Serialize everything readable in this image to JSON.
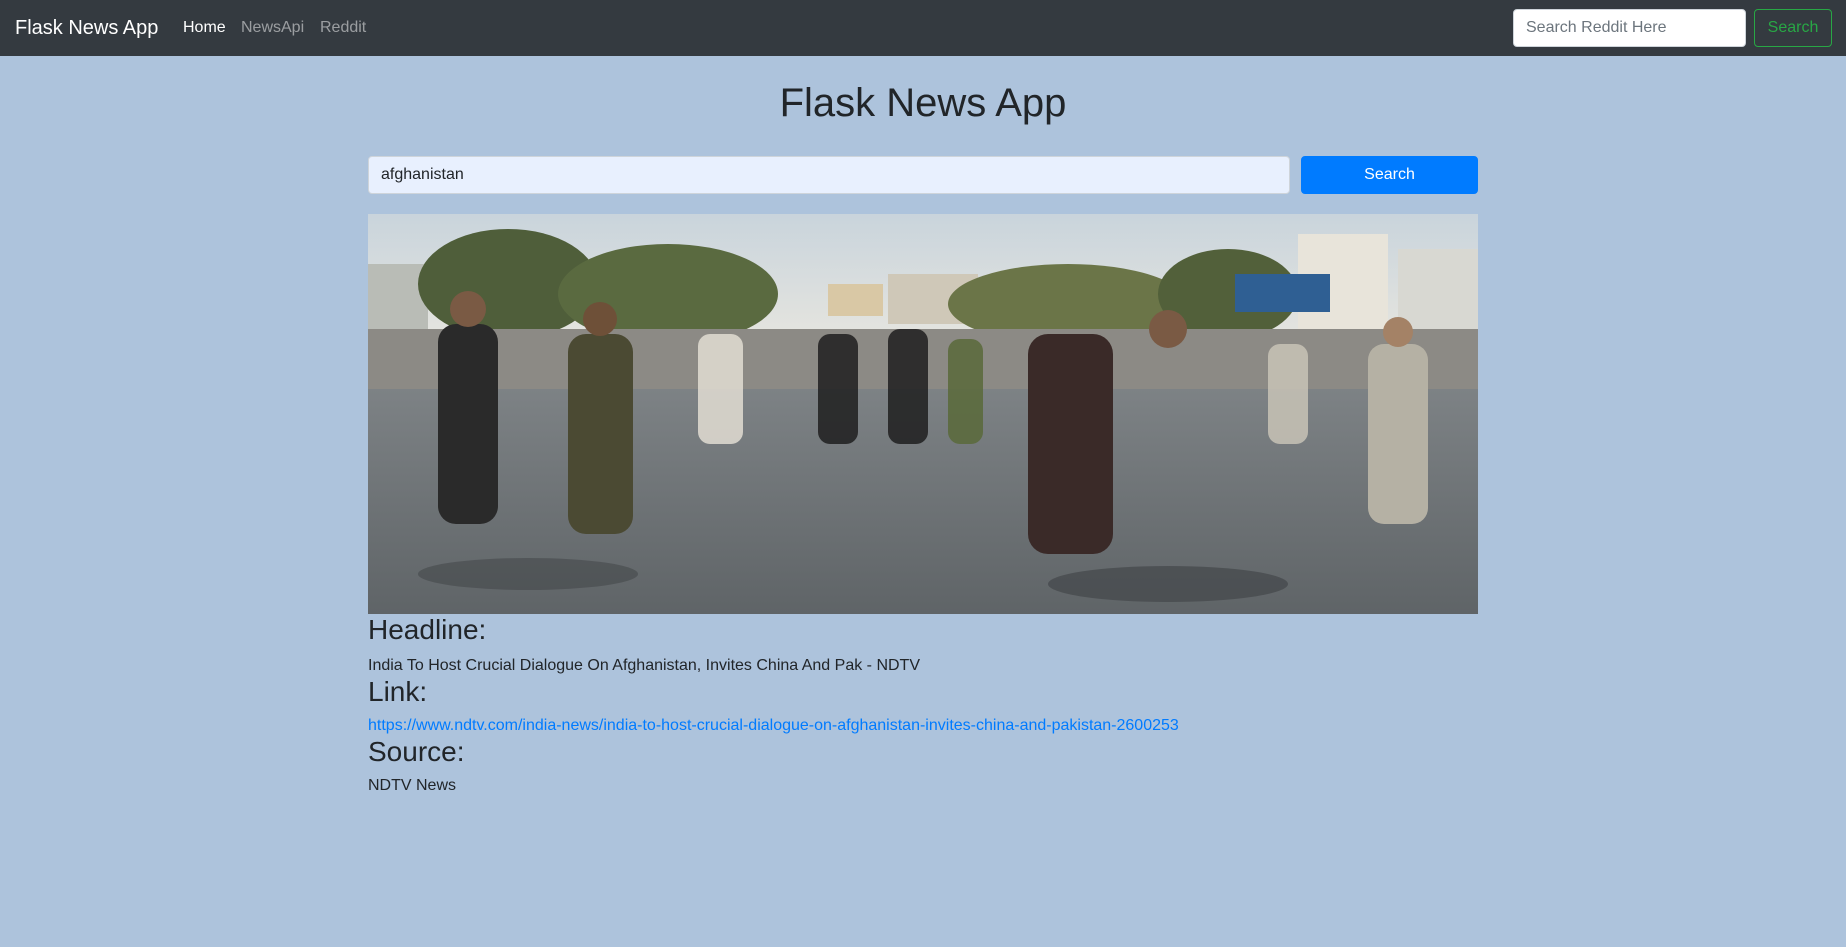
{
  "navbar": {
    "brand": "Flask News App",
    "links": [
      {
        "label": "Home",
        "active": true
      },
      {
        "label": "NewsApi",
        "active": false
      },
      {
        "label": "Reddit",
        "active": false
      }
    ],
    "search_placeholder": "Search Reddit Here",
    "search_button": "Search"
  },
  "main": {
    "title": "Flask News App",
    "search_value": "afghanistan",
    "search_button": "Search",
    "article": {
      "image_icon": "news-photo",
      "headline_label": "Headline:",
      "headline": "India To Host Crucial Dialogue On Afghanistan, Invites China And Pak - NDTV",
      "link_label": "Link:",
      "link": "https://www.ndtv.com/india-news/india-to-host-crucial-dialogue-on-afghanistan-invites-china-and-pakistan-2600253",
      "source_label": "Source:",
      "source": "NDTV News"
    }
  },
  "colors": {
    "page_background": "#adc3dc",
    "navbar_background": "#343a40",
    "primary": "#007bff",
    "success": "#28a745"
  }
}
